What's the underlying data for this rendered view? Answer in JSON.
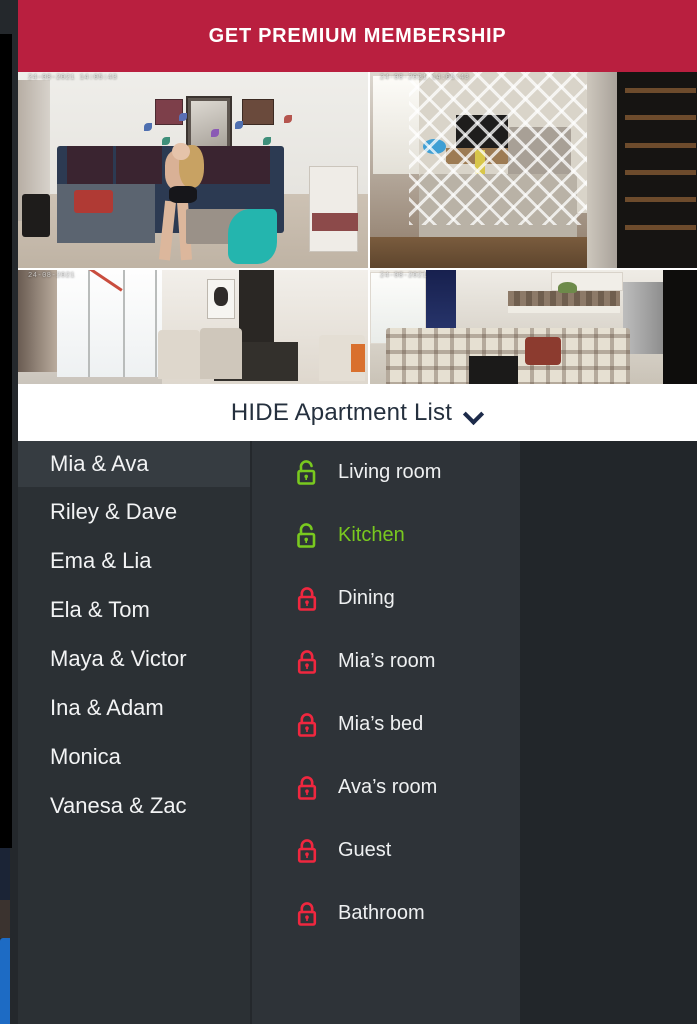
{
  "banner": {
    "label": "GET PREMIUM MEMBERSHIP",
    "background_color": "#b91f3f",
    "text_color": "#ffffff"
  },
  "camera_grid": {
    "tiles": [
      {
        "name": "cam-living-room",
        "timestamp": "24-08-2021 14:05:43",
        "scene": "living-room-sofa"
      },
      {
        "name": "cam-lattice-room",
        "timestamp": "24-08-2021 14:05:43",
        "scene": "lattice-living-room"
      },
      {
        "name": "cam-window-room",
        "timestamp": "24-08-2021",
        "scene": "bright-window-room"
      },
      {
        "name": "cam-kitchen",
        "timestamp": "24-08-2021",
        "scene": "kitchen-sectional"
      }
    ]
  },
  "hide_bar": {
    "label": "HIDE Apartment List",
    "chevron": "chevron-down-icon",
    "text_color": "#25303e",
    "background_color": "#ffffff"
  },
  "apartments": {
    "items": [
      {
        "label": "Mia & Ava",
        "selected": true
      },
      {
        "label": "Riley & Dave",
        "selected": false
      },
      {
        "label": "Ema & Lia",
        "selected": false
      },
      {
        "label": "Ela & Tom",
        "selected": false
      },
      {
        "label": "Maya & Victor",
        "selected": false
      },
      {
        "label": "Ina & Adam",
        "selected": false
      },
      {
        "label": "Monica",
        "selected": false
      },
      {
        "label": "Vanesa & Zac",
        "selected": false
      }
    ]
  },
  "rooms": {
    "unlocked_color": "#79c91f",
    "locked_color": "#f0273f",
    "items": [
      {
        "label": "Living room",
        "state": "unlocked",
        "icon": "unlock-icon",
        "selected": false
      },
      {
        "label": "Kitchen",
        "state": "unlocked",
        "icon": "unlock-icon",
        "selected": true
      },
      {
        "label": "Dining",
        "state": "locked",
        "icon": "lock-icon",
        "selected": false
      },
      {
        "label": "Mia’s room",
        "state": "locked",
        "icon": "lock-icon",
        "selected": false
      },
      {
        "label": "Mia’s bed",
        "state": "locked",
        "icon": "lock-icon",
        "selected": false
      },
      {
        "label": "Ava’s room",
        "state": "locked",
        "icon": "lock-icon",
        "selected": false
      },
      {
        "label": "Guest",
        "state": "locked",
        "icon": "lock-icon",
        "selected": false
      },
      {
        "label": "Bathroom",
        "state": "locked",
        "icon": "lock-icon",
        "selected": false
      }
    ]
  }
}
